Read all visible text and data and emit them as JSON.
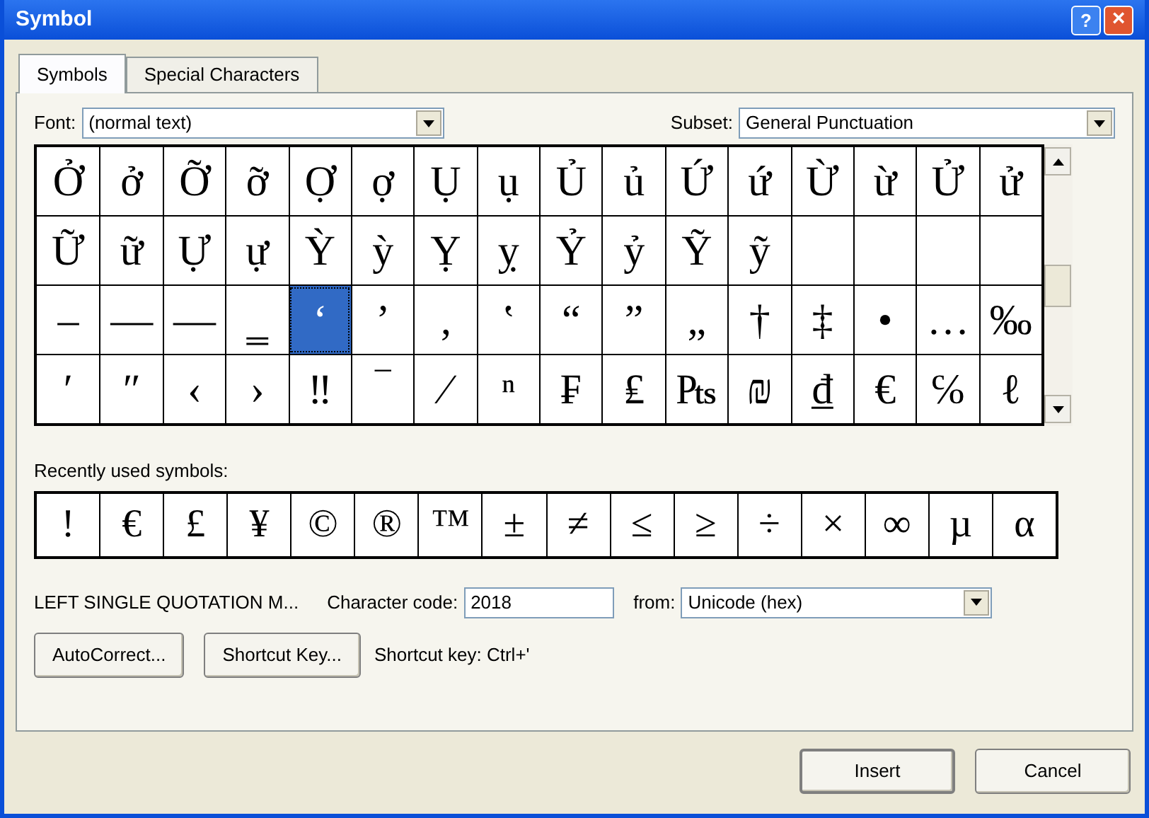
{
  "window": {
    "title": "Symbol",
    "help_button": "?",
    "close_button": "×"
  },
  "tabs": [
    {
      "label": "Symbols",
      "selected": true
    },
    {
      "label": "Special Characters",
      "selected": false
    }
  ],
  "font": {
    "label": "Font:",
    "value": "(normal text)"
  },
  "subset": {
    "label": "Subset:",
    "value": "General Punctuation"
  },
  "grid": {
    "rows": [
      [
        {
          "char": "Ở",
          "selected": false
        },
        {
          "char": "ở",
          "selected": false
        },
        {
          "char": "Ỡ",
          "selected": false
        },
        {
          "char": "ỡ",
          "selected": false
        },
        {
          "char": "Ợ",
          "selected": false
        },
        {
          "char": "ợ",
          "selected": false
        },
        {
          "char": "Ụ",
          "selected": false
        },
        {
          "char": "ụ",
          "selected": false
        },
        {
          "char": "Ủ",
          "selected": false
        },
        {
          "char": "ủ",
          "selected": false
        },
        {
          "char": "Ứ",
          "selected": false
        },
        {
          "char": "ứ",
          "selected": false
        },
        {
          "char": "Ừ",
          "selected": false
        },
        {
          "char": "ừ",
          "selected": false
        },
        {
          "char": "Ử",
          "selected": false
        },
        {
          "char": "ử",
          "selected": false
        }
      ],
      [
        {
          "char": "Ữ",
          "selected": false
        },
        {
          "char": "ữ",
          "selected": false
        },
        {
          "char": "Ự",
          "selected": false
        },
        {
          "char": "ự",
          "selected": false
        },
        {
          "char": "Ỳ",
          "selected": false
        },
        {
          "char": "ỳ",
          "selected": false
        },
        {
          "char": "Ỵ",
          "selected": false
        },
        {
          "char": "ỵ",
          "selected": false
        },
        {
          "char": "Ỷ",
          "selected": false
        },
        {
          "char": "ỷ",
          "selected": false
        },
        {
          "char": "Ỹ",
          "selected": false
        },
        {
          "char": "ỹ",
          "selected": false
        }
      ],
      [
        {
          "char": "–",
          "selected": false
        },
        {
          "char": "—",
          "selected": false
        },
        {
          "char": "―",
          "selected": false
        },
        {
          "char": "‗",
          "selected": false
        },
        {
          "char": "‘",
          "selected": true
        },
        {
          "char": "’",
          "selected": false
        },
        {
          "char": "‚",
          "selected": false
        },
        {
          "char": "‛",
          "selected": false
        },
        {
          "char": "“",
          "selected": false
        },
        {
          "char": "”",
          "selected": false
        },
        {
          "char": "„",
          "selected": false
        },
        {
          "char": "†",
          "selected": false
        },
        {
          "char": "‡",
          "selected": false
        },
        {
          "char": "•",
          "selected": false
        },
        {
          "char": "…",
          "selected": false
        },
        {
          "char": "‰",
          "selected": false
        }
      ],
      [
        {
          "char": "′",
          "selected": false
        },
        {
          "char": "″",
          "selected": false
        },
        {
          "char": "‹",
          "selected": false
        },
        {
          "char": "›",
          "selected": false
        },
        {
          "char": "‼",
          "selected": false
        },
        {
          "char": "‾",
          "selected": false
        },
        {
          "char": "⁄",
          "selected": false
        },
        {
          "char": "ⁿ",
          "selected": false
        },
        {
          "char": "₣",
          "selected": false
        },
        {
          "char": "₤",
          "selected": false
        },
        {
          "char": "₧",
          "selected": false
        },
        {
          "char": "₪",
          "selected": false
        },
        {
          "char": "₫",
          "selected": false
        },
        {
          "char": "€",
          "selected": false
        },
        {
          "char": "℅",
          "selected": false
        },
        {
          "char": "ℓ",
          "selected": false
        }
      ]
    ]
  },
  "recent": {
    "label": "Recently used symbols:",
    "symbols": [
      "!",
      "€",
      "£",
      "¥",
      "©",
      "®",
      "™",
      "±",
      "≠",
      "≤",
      "≥",
      "÷",
      "×",
      "∞",
      "µ",
      "α"
    ]
  },
  "char_name": "LEFT SINGLE QUOTATION M...",
  "char_code": {
    "label": "Character code:",
    "value": "2018"
  },
  "from": {
    "label": "from:",
    "value": "Unicode (hex)"
  },
  "buttons": [
    {
      "label": "AutoCorrect..."
    },
    {
      "label": "Shortcut Key..."
    }
  ],
  "shortcut_text": "Shortcut key: Ctrl+'",
  "footer_buttons": [
    {
      "label": "Insert",
      "default": true
    },
    {
      "label": "Cancel",
      "default": false
    }
  ]
}
